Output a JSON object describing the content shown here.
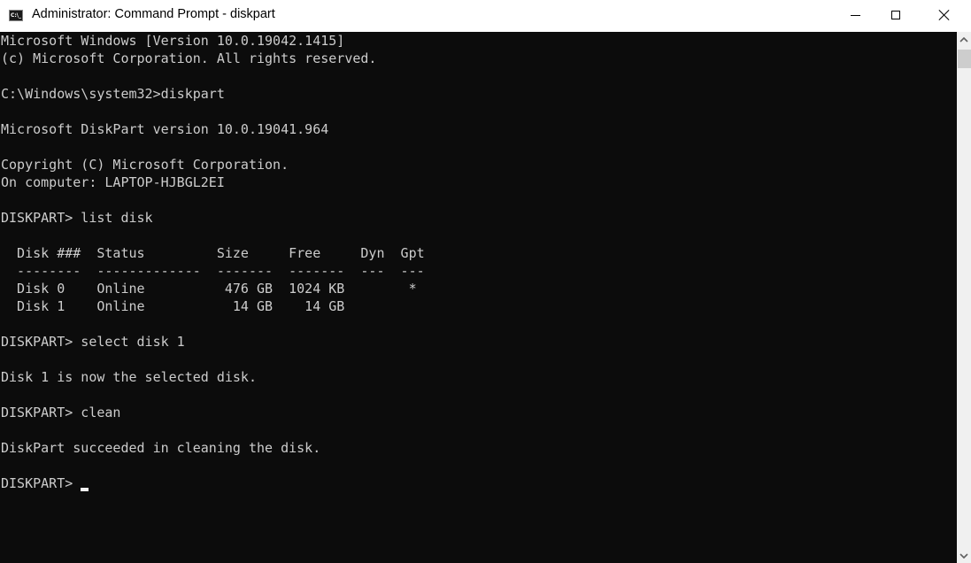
{
  "window": {
    "title": "Administrator: Command Prompt - diskpart",
    "icon": "cmd-icon",
    "icon_text": "C:\\_",
    "controls": [
      "minimize",
      "maximize",
      "close"
    ]
  },
  "console": {
    "background": "#0c0c0c",
    "foreground": "#cccccc",
    "lines": [
      "Microsoft Windows [Version 10.0.19042.1415]",
      "(c) Microsoft Corporation. All rights reserved.",
      "",
      "C:\\Windows\\system32>diskpart",
      "",
      "Microsoft DiskPart version 10.0.19041.964",
      "",
      "Copyright (C) Microsoft Corporation.",
      "On computer: LAPTOP-HJBGL2EI",
      "",
      "DISKPART> list disk",
      "",
      "  Disk ###  Status         Size     Free     Dyn  Gpt",
      "  --------  -------------  -------  -------  ---  ---",
      "  Disk 0    Online          476 GB  1024 KB        *",
      "  Disk 1    Online           14 GB    14 GB",
      "",
      "DISKPART> select disk 1",
      "",
      "Disk 1 is now the selected disk.",
      "",
      "DISKPART> clean",
      "",
      "DiskPart succeeded in cleaning the disk.",
      "",
      "DISKPART> "
    ],
    "disk_table": {
      "columns": [
        "Disk ###",
        "Status",
        "Size",
        "Free",
        "Dyn",
        "Gpt"
      ],
      "rows": [
        {
          "disk": "Disk 0",
          "status": "Online",
          "size": "476 GB",
          "free": "1024 KB",
          "dyn": "",
          "gpt": "*"
        },
        {
          "disk": "Disk 1",
          "status": "Online",
          "size": "14 GB",
          "free": "14 GB",
          "dyn": "",
          "gpt": ""
        }
      ]
    },
    "prompt": "DISKPART> "
  },
  "scrollbar": {
    "up_icon": "chevron-up-icon",
    "down_icon": "chevron-down-icon"
  }
}
